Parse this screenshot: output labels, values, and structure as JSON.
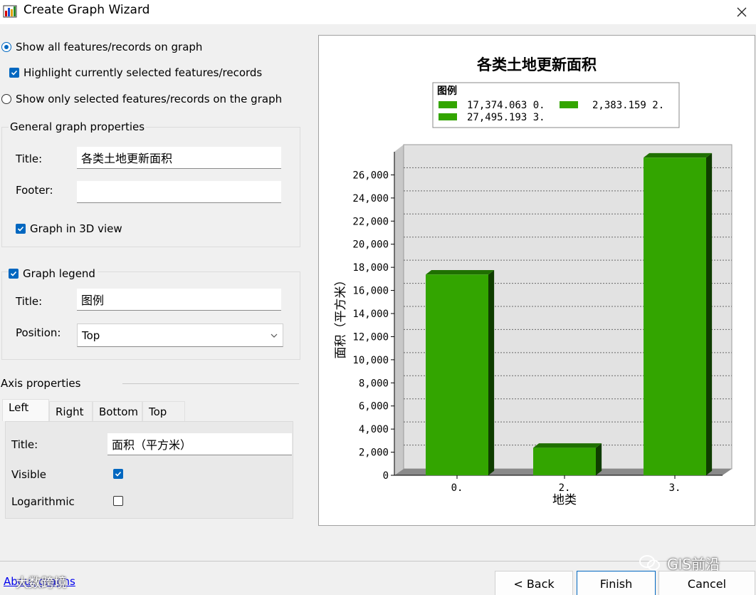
{
  "window": {
    "title": "Create Graph Wizard",
    "close_glyph": "✕"
  },
  "options": {
    "show_all_label": "Show all features/records on graph",
    "highlight_label": "Highlight currently selected features/records",
    "show_selected_label": "Show only selected features/records on the graph"
  },
  "general": {
    "group_label": "General graph properties",
    "title_label": "Title:",
    "title_value": "各类土地更新面积",
    "footer_label": "Footer:",
    "footer_value": "",
    "view3d_label": "Graph in 3D view"
  },
  "legend": {
    "group_label": "Graph legend",
    "title_label": "Title:",
    "title_value": "图例",
    "position_label": "Position:",
    "position_value": "Top"
  },
  "axis": {
    "group_label": "Axis properties",
    "tabs": [
      "Left",
      "Right",
      "Bottom",
      "Top"
    ],
    "title_label": "Title:",
    "title_value": "面积（平方米）",
    "visible_label": "Visible",
    "log_label": "Logarithmic"
  },
  "buttons": {
    "back": "< Back",
    "finish": "Finish",
    "cancel": "Cancel"
  },
  "footer": {
    "about": "About graphs",
    "watermark_left": "大数跨境",
    "watermark_right": "GIS前沿"
  },
  "colors": {
    "accent": "#0067c0",
    "bar_face": "#33a500",
    "bar_top": "#1f7000",
    "bar_side": "#0f3d00"
  },
  "chart_data": {
    "type": "bar",
    "title": "各类土地更新面积",
    "categories": [
      "0.",
      "2.",
      "3."
    ],
    "values": [
      17374.063,
      2383.159,
      27495.193
    ],
    "xlabel": "地类",
    "ylabel": "面积（平方米）",
    "ylim": [
      0,
      28000
    ],
    "yticks": [
      "0",
      "2,000",
      "4,000",
      "6,000",
      "8,000",
      "10,000",
      "12,000",
      "14,000",
      "16,000",
      "18,000",
      "20,000",
      "22,000",
      "24,000",
      "26,000"
    ],
    "legend_title": "图例",
    "legend_entries": [
      "17,374.063 0.",
      "2,383.159 2.",
      "27,495.193 3."
    ],
    "legend_position": "top",
    "grid": true,
    "view": "3d"
  }
}
